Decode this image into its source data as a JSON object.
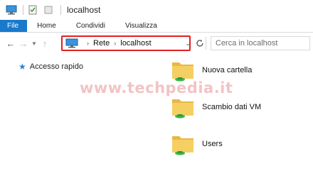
{
  "window": {
    "title": "localhost"
  },
  "ribbon": {
    "tabs": [
      "File",
      "Home",
      "Condividi",
      "Visualizza"
    ]
  },
  "address": {
    "crumbs": [
      "Rete",
      "localhost"
    ]
  },
  "search": {
    "placeholder": "Cerca in localhost"
  },
  "nav": {
    "quick_access_label": "Accesso rapido"
  },
  "items": [
    {
      "name": "Nuova cartella"
    },
    {
      "name": "Scambio dati VM"
    },
    {
      "name": "Users"
    }
  ],
  "watermark": {
    "text": "www.techpedia.it"
  },
  "colors": {
    "file_tab": "#1979ca",
    "address_highlight": "#e02020",
    "folder": "#f1c75a",
    "share_badge": "#3bb54a"
  },
  "icons": [
    "computer-icon",
    "properties-icon",
    "new-folder-icon",
    "back-arrow-icon",
    "forward-arrow-icon",
    "recent-locations-icon",
    "up-arrow-icon",
    "refresh-icon",
    "dropdown-icon",
    "star-icon",
    "shared-folder-icon"
  ]
}
